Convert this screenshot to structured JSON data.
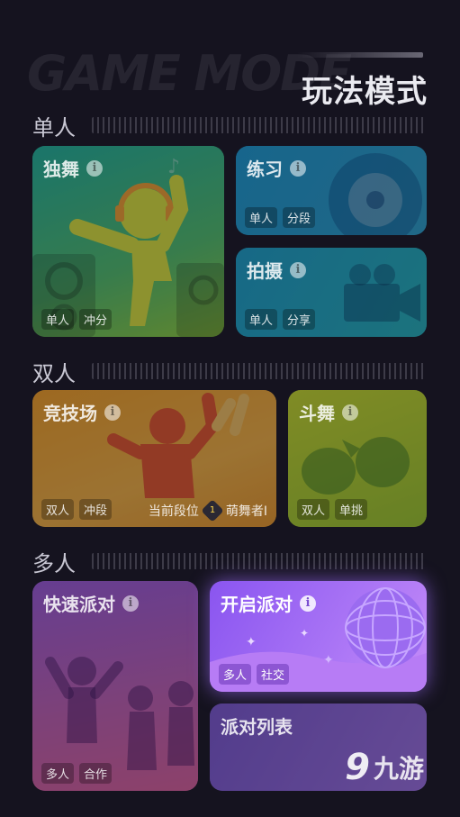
{
  "header": {
    "bg_text": "GAME MODE",
    "title": "玩法模式"
  },
  "sections": {
    "single": "单人",
    "double": "双人",
    "multi": "多人"
  },
  "cards": {
    "solo_dance": {
      "title": "独舞",
      "tags": [
        "单人",
        "冲分"
      ]
    },
    "practice": {
      "title": "练习",
      "tags": [
        "单人",
        "分段"
      ]
    },
    "shoot": {
      "title": "拍摄",
      "tags": [
        "单人",
        "分享"
      ]
    },
    "arena": {
      "title": "竞技场",
      "tags": [
        "双人",
        "冲段"
      ],
      "rank_label": "当前段位",
      "rank_value": "萌舞者I",
      "rank_badge": "1"
    },
    "battle": {
      "title": "斗舞",
      "tags": [
        "双人",
        "单挑"
      ]
    },
    "quick_party": {
      "title": "快速派对",
      "tags": [
        "多人",
        "合作"
      ]
    },
    "open_party": {
      "title": "开启派对",
      "tags": [
        "多人",
        "社交"
      ]
    },
    "party_list": {
      "title": "派对列表"
    }
  },
  "watermark": {
    "mark": "9",
    "text": "九游"
  },
  "colors": {
    "background": "#15131f",
    "solo": "#2bb8a0",
    "practice": "#1fa5d6",
    "arena": "#f5a623",
    "battle": "#b8d62a",
    "party_purple": "#9a5bf5"
  }
}
